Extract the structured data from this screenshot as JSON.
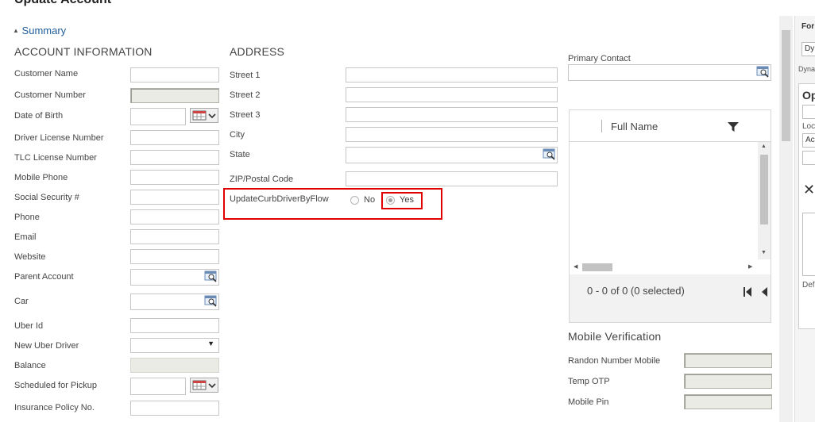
{
  "header": {
    "title": "Update Account"
  },
  "summary": {
    "label": "Summary",
    "toggle_glyph": "▲"
  },
  "account_info": {
    "heading": "ACCOUNT INFORMATION",
    "fields": {
      "customer_name": "Customer Name",
      "customer_number": "Customer Number",
      "date_of_birth": "Date of Birth",
      "driver_license": "Driver License Number",
      "tlc_license": "TLC License Number",
      "mobile_phone": "Mobile Phone",
      "ssn": "Social Security #",
      "phone": "Phone",
      "email": "Email",
      "website": "Website",
      "parent_account": "Parent Account",
      "car": "Car",
      "uber_id": "Uber Id",
      "new_uber_driver": "New Uber Driver",
      "balance": "Balance",
      "scheduled_pickup": "Scheduled for Pickup",
      "insurance_policy": "Insurance Policy No."
    }
  },
  "address": {
    "heading": "ADDRESS",
    "fields": {
      "street1": "Street 1",
      "street2": "Street 2",
      "street3": "Street 3",
      "city": "City",
      "state": "State",
      "zip": "ZIP/Postal Code",
      "update_flow": "UpdateCurbDriverByFlow"
    },
    "radio": {
      "no": "No",
      "yes": "Yes",
      "selected": "Yes"
    }
  },
  "contacts": {
    "primary_label": "Primary Contact",
    "grid_column": "Full Name",
    "pager_text": "0 - 0 of 0 (0 selected)"
  },
  "mobile_verification": {
    "heading": "Mobile Verification",
    "fields": {
      "random_number": "Randon Number Mobile",
      "temp_otp": "Temp OTP",
      "mobile_pin": "Mobile Pin"
    }
  },
  "right_panel": {
    "label_top": "For",
    "select_value": "Dy",
    "label_dyna": "Dyna",
    "heading_op": "Op",
    "label_loc": "Loc",
    "select_ac": "Ac",
    "label_def": "Def",
    "close_glyph": "✕"
  },
  "colors": {
    "highlight": "#e00000",
    "link_blue": "#1f5c99",
    "readonly_bg": "#ebebe6"
  }
}
